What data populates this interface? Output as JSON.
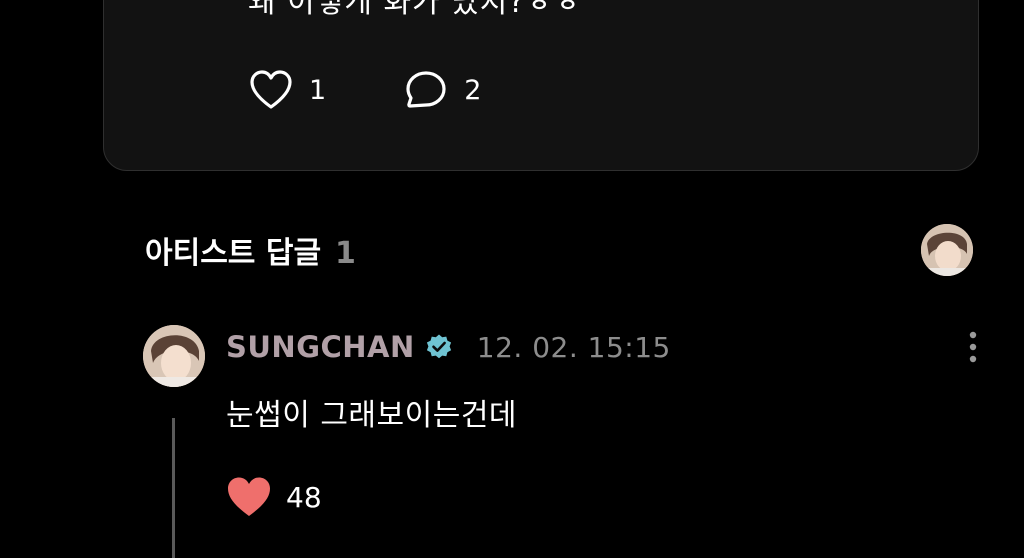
{
  "post": {
    "text": "왜 이렇게 화가 났지?ㅎㅎ",
    "like_count": "1",
    "comment_count": "2"
  },
  "artist_replies": {
    "title": "아티스트 답글",
    "count": "1"
  },
  "reply": {
    "author": "SUNGCHAN",
    "timestamp": "12. 02. 15:15",
    "text": "눈썹이 그래보이는건데",
    "like_count": "48"
  },
  "colors": {
    "background": "#000000",
    "card": "#121212",
    "author_name": "#b1a0a7",
    "verified_badge": "#6fc3d2",
    "liked_heart": "#ef6f6c",
    "muted_text": "#8d8d8d"
  },
  "icons": {
    "like": "heart-outline-icon",
    "comment": "speech-bubble-icon",
    "verified": "verified-badge-icon",
    "more": "vertical-ellipsis-icon",
    "liked": "heart-filled-icon"
  }
}
